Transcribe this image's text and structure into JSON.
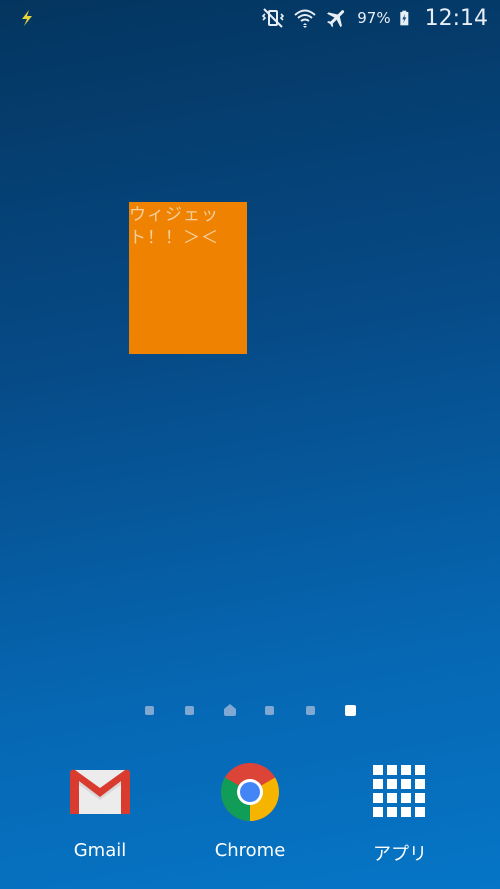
{
  "status_bar": {
    "battery_percent": "97%",
    "time": "12:14",
    "left_icon": "charging-bolt-icon",
    "icons": [
      "vibrate-mute-icon",
      "wifi-icon",
      "airplane-mode-icon",
      "battery-charging-icon"
    ]
  },
  "widget": {
    "text": "ウィジェット！！＞＜",
    "background_color": "#ef8200"
  },
  "page_indicator": {
    "pages": 6,
    "home_index": 2,
    "active_index": 5
  },
  "dock": {
    "apps": [
      {
        "label": "Gmail",
        "icon": "gmail-icon"
      },
      {
        "label": "Chrome",
        "icon": "chrome-icon"
      },
      {
        "label": "アプリ",
        "icon": "apps-grid-icon"
      }
    ]
  }
}
